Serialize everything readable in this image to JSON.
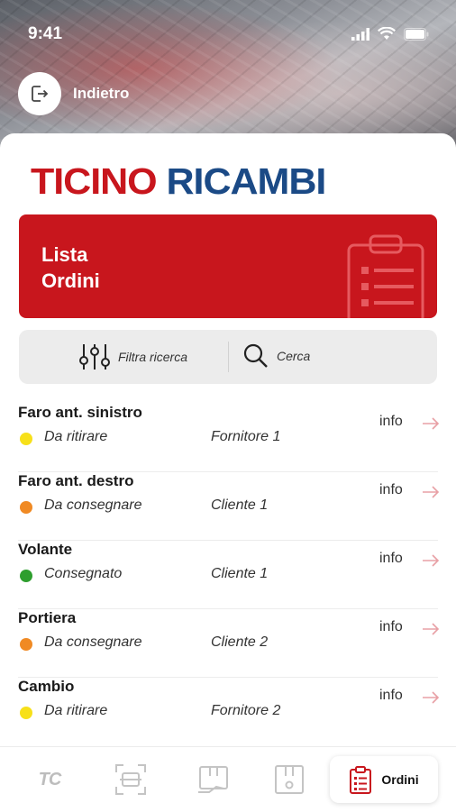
{
  "status_bar": {
    "time": "9:41"
  },
  "header": {
    "back_label": "Indietro"
  },
  "brand": {
    "name_part1": "TICINO",
    "name_part2": "RICAMBI",
    "color_red": "#c8161d",
    "color_blue": "#1b4a86"
  },
  "banner": {
    "title": "Lista\nOrdini",
    "icon": "clipboard-icon"
  },
  "toolbar": {
    "filter_label": "Filtra ricerca",
    "search_label": "Cerca"
  },
  "orders": [
    {
      "title": "Faro ant. sinistro",
      "status": "Da ritirare",
      "status_color": "#f7e01a",
      "party": "Fornitore 1",
      "info": "info"
    },
    {
      "title": "Faro ant. destro",
      "status": "Da consegnare",
      "status_color": "#f08a24",
      "party": "Cliente 1",
      "info": "info"
    },
    {
      "title": "Volante",
      "status": "Consegnato",
      "status_color": "#2e9e2e",
      "party": "Cliente 1",
      "info": "info"
    },
    {
      "title": "Portiera",
      "status": "Da consegnare",
      "status_color": "#f08a24",
      "party": "Cliente 2",
      "info": "info"
    },
    {
      "title": "Cambio",
      "status": "Da ritirare",
      "status_color": "#f7e01a",
      "party": "Fornitore 2",
      "info": "info"
    }
  ],
  "tabbar": {
    "tc_logo": "TC",
    "active_label": "Ordini",
    "tabs": [
      "tc-logo-icon",
      "scan-icon",
      "package-handover-icon",
      "package-icon",
      "clipboard-icon"
    ]
  }
}
